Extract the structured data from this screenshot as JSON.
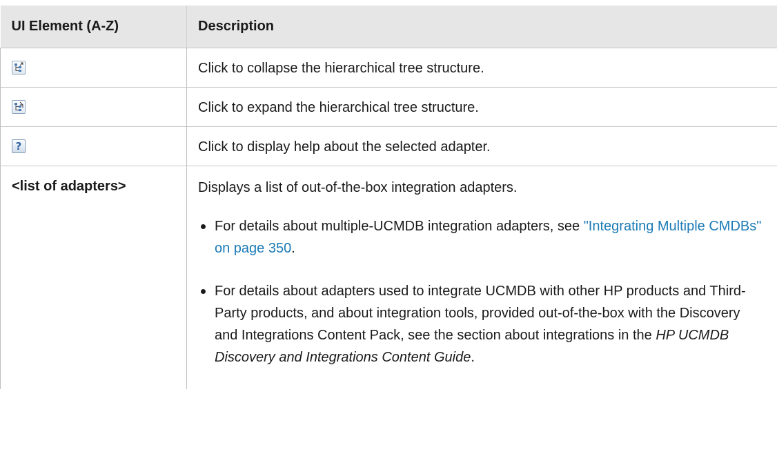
{
  "table": {
    "headers": {
      "element": "UI Element (A-Z)",
      "description": "Description"
    },
    "rows": [
      {
        "icon": "collapse-tree-icon",
        "description": "Click to collapse the hierarchical tree structure."
      },
      {
        "icon": "expand-tree-icon",
        "description": "Click to expand the hierarchical tree structure."
      },
      {
        "icon": "help-icon",
        "icon_glyph": "?",
        "description": "Click to display help about the selected adapter."
      }
    ],
    "adapters_row": {
      "element": "<list of adapters>",
      "intro": "Displays a list of out-of-the-box integration adapters.",
      "bullet1": {
        "text_before": "For details about multiple-UCMDB integration adapters, see ",
        "link": "\"Integrating Multiple CMDBs\" on page 350",
        "text_after": "."
      },
      "bullet2": {
        "text_before": "For details about adapters used to integrate UCMDB with other HP products and Third-Party products, and about integration tools, provided out-of-the-box with the Discovery and Integrations Content Pack, see the section about integrations in the ",
        "italic": "HP UCMDB Discovery and Integrations Content Guide",
        "text_after": "."
      }
    }
  },
  "colors": {
    "header_bg": "#e6e6e6",
    "link": "#1b7ab5",
    "text": "#1a1a1a"
  }
}
